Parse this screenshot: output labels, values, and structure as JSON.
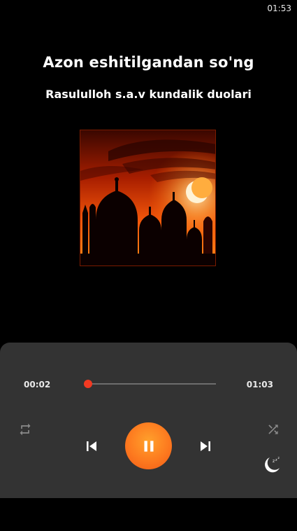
{
  "status_bar": {
    "time": "01:53"
  },
  "track": {
    "title": "Azon eshitilgandan so'ng",
    "subtitle": "Rasululloh s.a.v kundalik duolari",
    "cover_icon": "mosque-sunset-artwork"
  },
  "player": {
    "current_time": "00:02",
    "total_time": "01:03",
    "progress": 0.032,
    "state": "playing"
  },
  "colors": {
    "accent": "#f23a22",
    "play_button": "#fd7a1f",
    "panel": "#333333",
    "background": "#000000"
  },
  "icons": {
    "repeat": "repeat-icon",
    "shuffle": "shuffle-icon",
    "previous": "skip-previous-icon",
    "pause": "pause-icon",
    "next": "skip-next-icon",
    "sleep": "sleep-timer-icon"
  }
}
